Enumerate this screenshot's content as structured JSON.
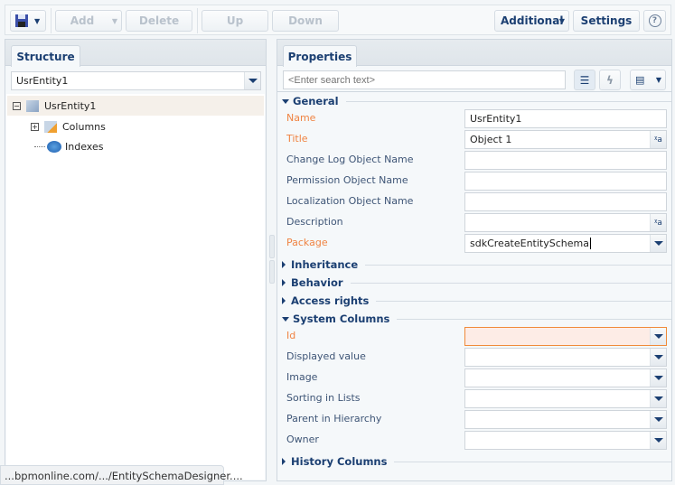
{
  "toolbar": {
    "save_icon": "floppy-disk-icon",
    "add": "Add",
    "delete": "Delete",
    "up": "Up",
    "down": "Down",
    "additional": "Additional",
    "settings": "Settings",
    "help_icon": "question-icon"
  },
  "structure": {
    "tab": "Structure",
    "schema_select": "UsrEntity1",
    "tree": [
      {
        "label": "UsrEntity1",
        "icon": "entity-cube-icon",
        "expanded": true,
        "selected": true
      },
      {
        "label": "Columns",
        "icon": "columns-icon",
        "expanded": false
      },
      {
        "label": "Indexes",
        "icon": "indexes-icon"
      }
    ]
  },
  "properties": {
    "tab": "Properties",
    "search_placeholder": "<Enter search text>",
    "sections": {
      "general": "General",
      "inheritance": "Inheritance",
      "behavior": "Behavior",
      "access": "Access rights",
      "system": "System Columns",
      "history": "History Columns"
    },
    "general": [
      {
        "label": "Name",
        "value": "UsrEntity1",
        "required": true
      },
      {
        "label": "Title",
        "value": "Object 1",
        "required": true,
        "localizable": true
      },
      {
        "label": "Change Log Object Name",
        "value": ""
      },
      {
        "label": "Permission Object Name",
        "value": ""
      },
      {
        "label": "Localization Object Name",
        "value": ""
      },
      {
        "label": "Description",
        "value": "",
        "localizable": true
      },
      {
        "label": "Package",
        "value": "sdkCreateEntitySchema",
        "required": true,
        "dropdown": true
      }
    ],
    "system": [
      {
        "label": "Id",
        "value": "",
        "required": true,
        "invalid": true
      },
      {
        "label": "Displayed value",
        "value": ""
      },
      {
        "label": "Image",
        "value": ""
      },
      {
        "label": "Sorting in Lists",
        "value": ""
      },
      {
        "label": "Parent in Hierarchy",
        "value": ""
      },
      {
        "label": "Owner",
        "value": ""
      }
    ]
  },
  "status_url": "...bpmonline.com/.../EntitySchemaDesigner....",
  "colors": {
    "accent": "#1b3f72",
    "required": "#f08443",
    "invalid_bg": "#fdece6",
    "selected_row": "#f5f0ea"
  }
}
